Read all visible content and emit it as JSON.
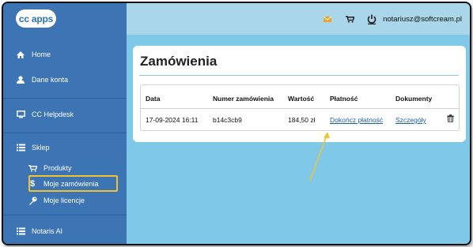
{
  "sidebar": {
    "logo": "cc apps",
    "items": [
      {
        "label": "Home",
        "icon": "home-icon"
      },
      {
        "label": "Dane konta",
        "icon": "user-icon"
      },
      {
        "label": "CC Helpdesk",
        "icon": "monitor-icon"
      },
      {
        "label": "Sklep",
        "icon": "list-icon"
      },
      {
        "label": "Produkty",
        "icon": "cart-icon"
      },
      {
        "label": "Moje zamówienia",
        "icon": "dollar-icon"
      },
      {
        "label": "Moje licencje",
        "icon": "key-icon"
      },
      {
        "label": "Notaris AI",
        "icon": "list-icon"
      }
    ],
    "active_item": "Moje zamówienia"
  },
  "topbar": {
    "email": "notariusz@softcream.pl",
    "icons": [
      "envelope-icon",
      "cart-icon",
      "power-icon"
    ]
  },
  "main": {
    "title": "Zamówienia",
    "table": {
      "headers": [
        "Data",
        "Numer zamówienia",
        "Wartość",
        "Płatność",
        "Dokumenty"
      ],
      "rows": [
        {
          "date": "17-09-2024 16:11",
          "number": "b14c3cb9",
          "value": "184,50 zł",
          "payment_link": "Dokończ płatność",
          "documents_link": "Szczegóły"
        }
      ]
    }
  },
  "colors": {
    "sidebar_bg": "#3d74b3",
    "topbar_bg": "#a9d6e9",
    "content_bg": "#80c8e8",
    "highlight_box": "#f2c230",
    "annotation_arrow": "#f2c230",
    "link": "#1f5fae"
  }
}
